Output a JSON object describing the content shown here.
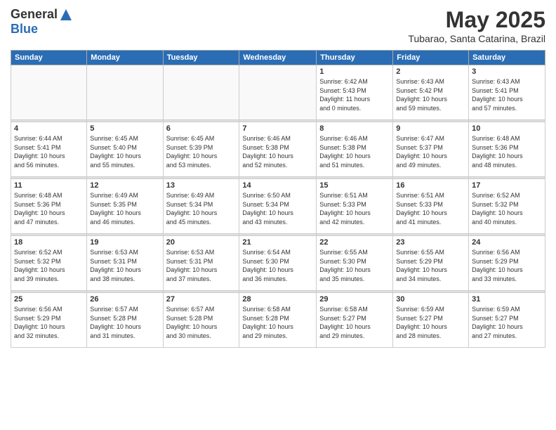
{
  "logo": {
    "general": "General",
    "blue": "Blue"
  },
  "title": "May 2025",
  "subtitle": "Tubarao, Santa Catarina, Brazil",
  "headers": [
    "Sunday",
    "Monday",
    "Tuesday",
    "Wednesday",
    "Thursday",
    "Friday",
    "Saturday"
  ],
  "weeks": [
    [
      {
        "day": "",
        "info": ""
      },
      {
        "day": "",
        "info": ""
      },
      {
        "day": "",
        "info": ""
      },
      {
        "day": "",
        "info": ""
      },
      {
        "day": "1",
        "info": "Sunrise: 6:42 AM\nSunset: 5:43 PM\nDaylight: 11 hours\nand 0 minutes."
      },
      {
        "day": "2",
        "info": "Sunrise: 6:43 AM\nSunset: 5:42 PM\nDaylight: 10 hours\nand 59 minutes."
      },
      {
        "day": "3",
        "info": "Sunrise: 6:43 AM\nSunset: 5:41 PM\nDaylight: 10 hours\nand 57 minutes."
      }
    ],
    [
      {
        "day": "4",
        "info": "Sunrise: 6:44 AM\nSunset: 5:41 PM\nDaylight: 10 hours\nand 56 minutes."
      },
      {
        "day": "5",
        "info": "Sunrise: 6:45 AM\nSunset: 5:40 PM\nDaylight: 10 hours\nand 55 minutes."
      },
      {
        "day": "6",
        "info": "Sunrise: 6:45 AM\nSunset: 5:39 PM\nDaylight: 10 hours\nand 53 minutes."
      },
      {
        "day": "7",
        "info": "Sunrise: 6:46 AM\nSunset: 5:38 PM\nDaylight: 10 hours\nand 52 minutes."
      },
      {
        "day": "8",
        "info": "Sunrise: 6:46 AM\nSunset: 5:38 PM\nDaylight: 10 hours\nand 51 minutes."
      },
      {
        "day": "9",
        "info": "Sunrise: 6:47 AM\nSunset: 5:37 PM\nDaylight: 10 hours\nand 49 minutes."
      },
      {
        "day": "10",
        "info": "Sunrise: 6:48 AM\nSunset: 5:36 PM\nDaylight: 10 hours\nand 48 minutes."
      }
    ],
    [
      {
        "day": "11",
        "info": "Sunrise: 6:48 AM\nSunset: 5:36 PM\nDaylight: 10 hours\nand 47 minutes."
      },
      {
        "day": "12",
        "info": "Sunrise: 6:49 AM\nSunset: 5:35 PM\nDaylight: 10 hours\nand 46 minutes."
      },
      {
        "day": "13",
        "info": "Sunrise: 6:49 AM\nSunset: 5:34 PM\nDaylight: 10 hours\nand 45 minutes."
      },
      {
        "day": "14",
        "info": "Sunrise: 6:50 AM\nSunset: 5:34 PM\nDaylight: 10 hours\nand 43 minutes."
      },
      {
        "day": "15",
        "info": "Sunrise: 6:51 AM\nSunset: 5:33 PM\nDaylight: 10 hours\nand 42 minutes."
      },
      {
        "day": "16",
        "info": "Sunrise: 6:51 AM\nSunset: 5:33 PM\nDaylight: 10 hours\nand 41 minutes."
      },
      {
        "day": "17",
        "info": "Sunrise: 6:52 AM\nSunset: 5:32 PM\nDaylight: 10 hours\nand 40 minutes."
      }
    ],
    [
      {
        "day": "18",
        "info": "Sunrise: 6:52 AM\nSunset: 5:32 PM\nDaylight: 10 hours\nand 39 minutes."
      },
      {
        "day": "19",
        "info": "Sunrise: 6:53 AM\nSunset: 5:31 PM\nDaylight: 10 hours\nand 38 minutes."
      },
      {
        "day": "20",
        "info": "Sunrise: 6:53 AM\nSunset: 5:31 PM\nDaylight: 10 hours\nand 37 minutes."
      },
      {
        "day": "21",
        "info": "Sunrise: 6:54 AM\nSunset: 5:30 PM\nDaylight: 10 hours\nand 36 minutes."
      },
      {
        "day": "22",
        "info": "Sunrise: 6:55 AM\nSunset: 5:30 PM\nDaylight: 10 hours\nand 35 minutes."
      },
      {
        "day": "23",
        "info": "Sunrise: 6:55 AM\nSunset: 5:29 PM\nDaylight: 10 hours\nand 34 minutes."
      },
      {
        "day": "24",
        "info": "Sunrise: 6:56 AM\nSunset: 5:29 PM\nDaylight: 10 hours\nand 33 minutes."
      }
    ],
    [
      {
        "day": "25",
        "info": "Sunrise: 6:56 AM\nSunset: 5:29 PM\nDaylight: 10 hours\nand 32 minutes."
      },
      {
        "day": "26",
        "info": "Sunrise: 6:57 AM\nSunset: 5:28 PM\nDaylight: 10 hours\nand 31 minutes."
      },
      {
        "day": "27",
        "info": "Sunrise: 6:57 AM\nSunset: 5:28 PM\nDaylight: 10 hours\nand 30 minutes."
      },
      {
        "day": "28",
        "info": "Sunrise: 6:58 AM\nSunset: 5:28 PM\nDaylight: 10 hours\nand 29 minutes."
      },
      {
        "day": "29",
        "info": "Sunrise: 6:58 AM\nSunset: 5:27 PM\nDaylight: 10 hours\nand 29 minutes."
      },
      {
        "day": "30",
        "info": "Sunrise: 6:59 AM\nSunset: 5:27 PM\nDaylight: 10 hours\nand 28 minutes."
      },
      {
        "day": "31",
        "info": "Sunrise: 6:59 AM\nSunset: 5:27 PM\nDaylight: 10 hours\nand 27 minutes."
      }
    ]
  ]
}
